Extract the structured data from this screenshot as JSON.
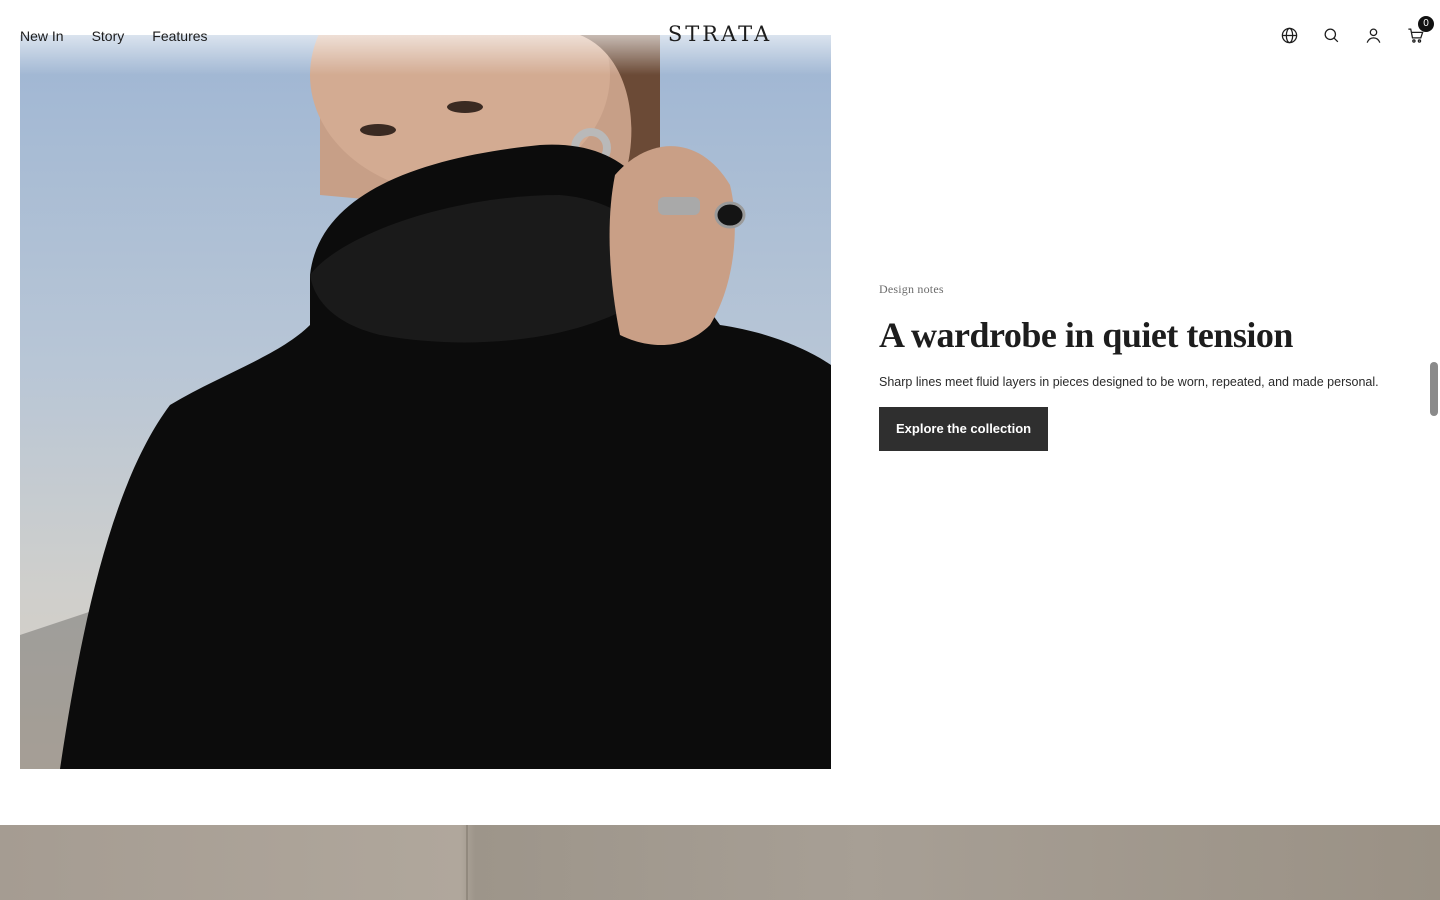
{
  "header": {
    "nav": [
      "New In",
      "Story",
      "Features"
    ],
    "logo": "STRATA",
    "icons": [
      "globe-icon",
      "search-icon",
      "account-icon",
      "cart-icon"
    ],
    "cart_count": "0"
  },
  "hero": {
    "eyebrow": "Design notes",
    "headline": "A wardrobe in quiet tension",
    "body": "Sharp lines meet fluid layers in pieces designed to be worn, repeated, and made personal.",
    "cta_label": "Explore the collection"
  },
  "colors": {
    "text": "#1d1d1d",
    "button": "#2f2f2f",
    "sky": "#9fb6d3"
  }
}
